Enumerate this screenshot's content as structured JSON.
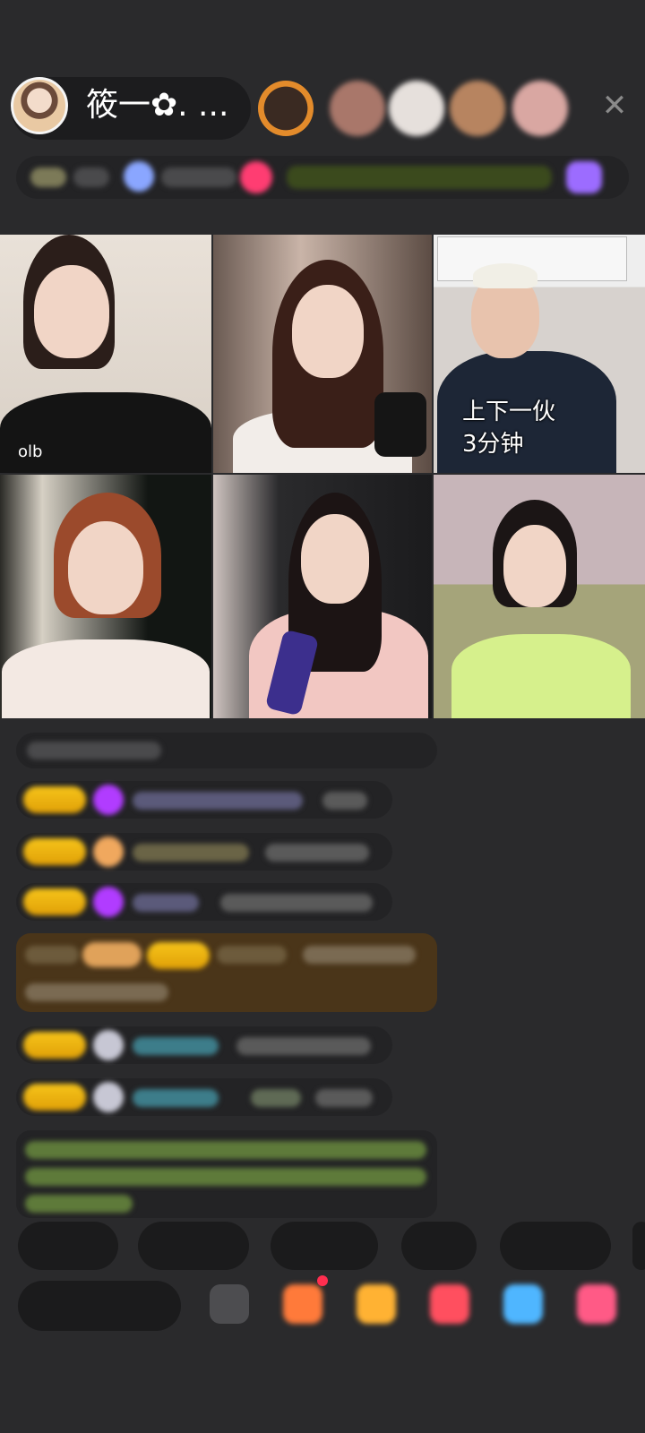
{
  "host": {
    "name": "筱一✿. ..."
  },
  "video_grid": {
    "caption": "上下一伙\n3分钟"
  },
  "controls": {
    "close_icon": "close-icon"
  },
  "colors": {
    "badge": "#f6c41a",
    "chat_bg": "#232325",
    "background": "#2a2a2c"
  }
}
